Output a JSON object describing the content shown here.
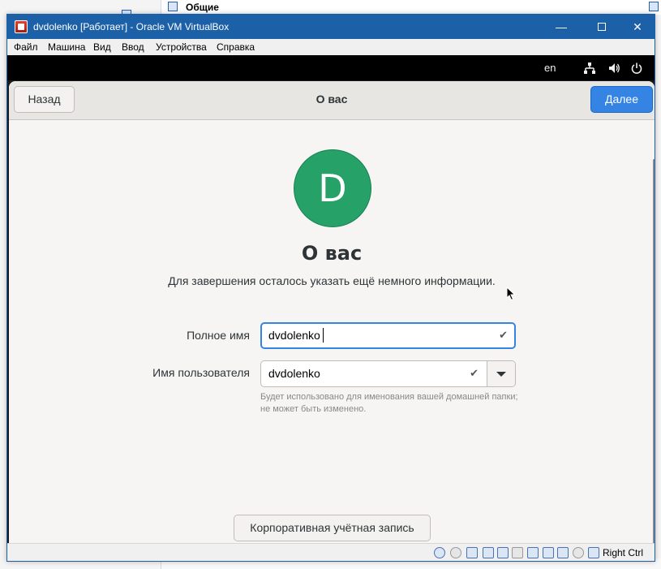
{
  "host": {
    "right_panel_label": "Общие"
  },
  "window": {
    "title": "dvdolenko [Работает] - Oracle VM VirtualBox",
    "minimize_glyph": "—",
    "close_glyph": "✕"
  },
  "menu": {
    "items": [
      "Файл",
      "Машина",
      "Вид",
      "Ввод",
      "Устройства",
      "Справка"
    ]
  },
  "gnome_topbar": {
    "language": "en",
    "icons": [
      "network-icon",
      "volume-icon",
      "power-icon"
    ]
  },
  "setup": {
    "back_label": "Назад",
    "header_title": "О вас",
    "next_label": "Далее",
    "avatar_letter": "D",
    "avatar_color": "#26a269",
    "heading": "О вас",
    "subtitle": "Для завершения осталось указать ещё немного информации.",
    "full_name_label": "Полное имя",
    "full_name_value": "dvdolenko",
    "username_label": "Имя пользователя",
    "username_value": "dvdolenko",
    "username_hint": "Будет использовано для именования вашей домашней папки; не может быть изменено.",
    "enterprise_label": "Корпоративная учётная запись",
    "accent_color": "#3584e4"
  },
  "statusbar": {
    "host_key": "Right Ctrl"
  }
}
